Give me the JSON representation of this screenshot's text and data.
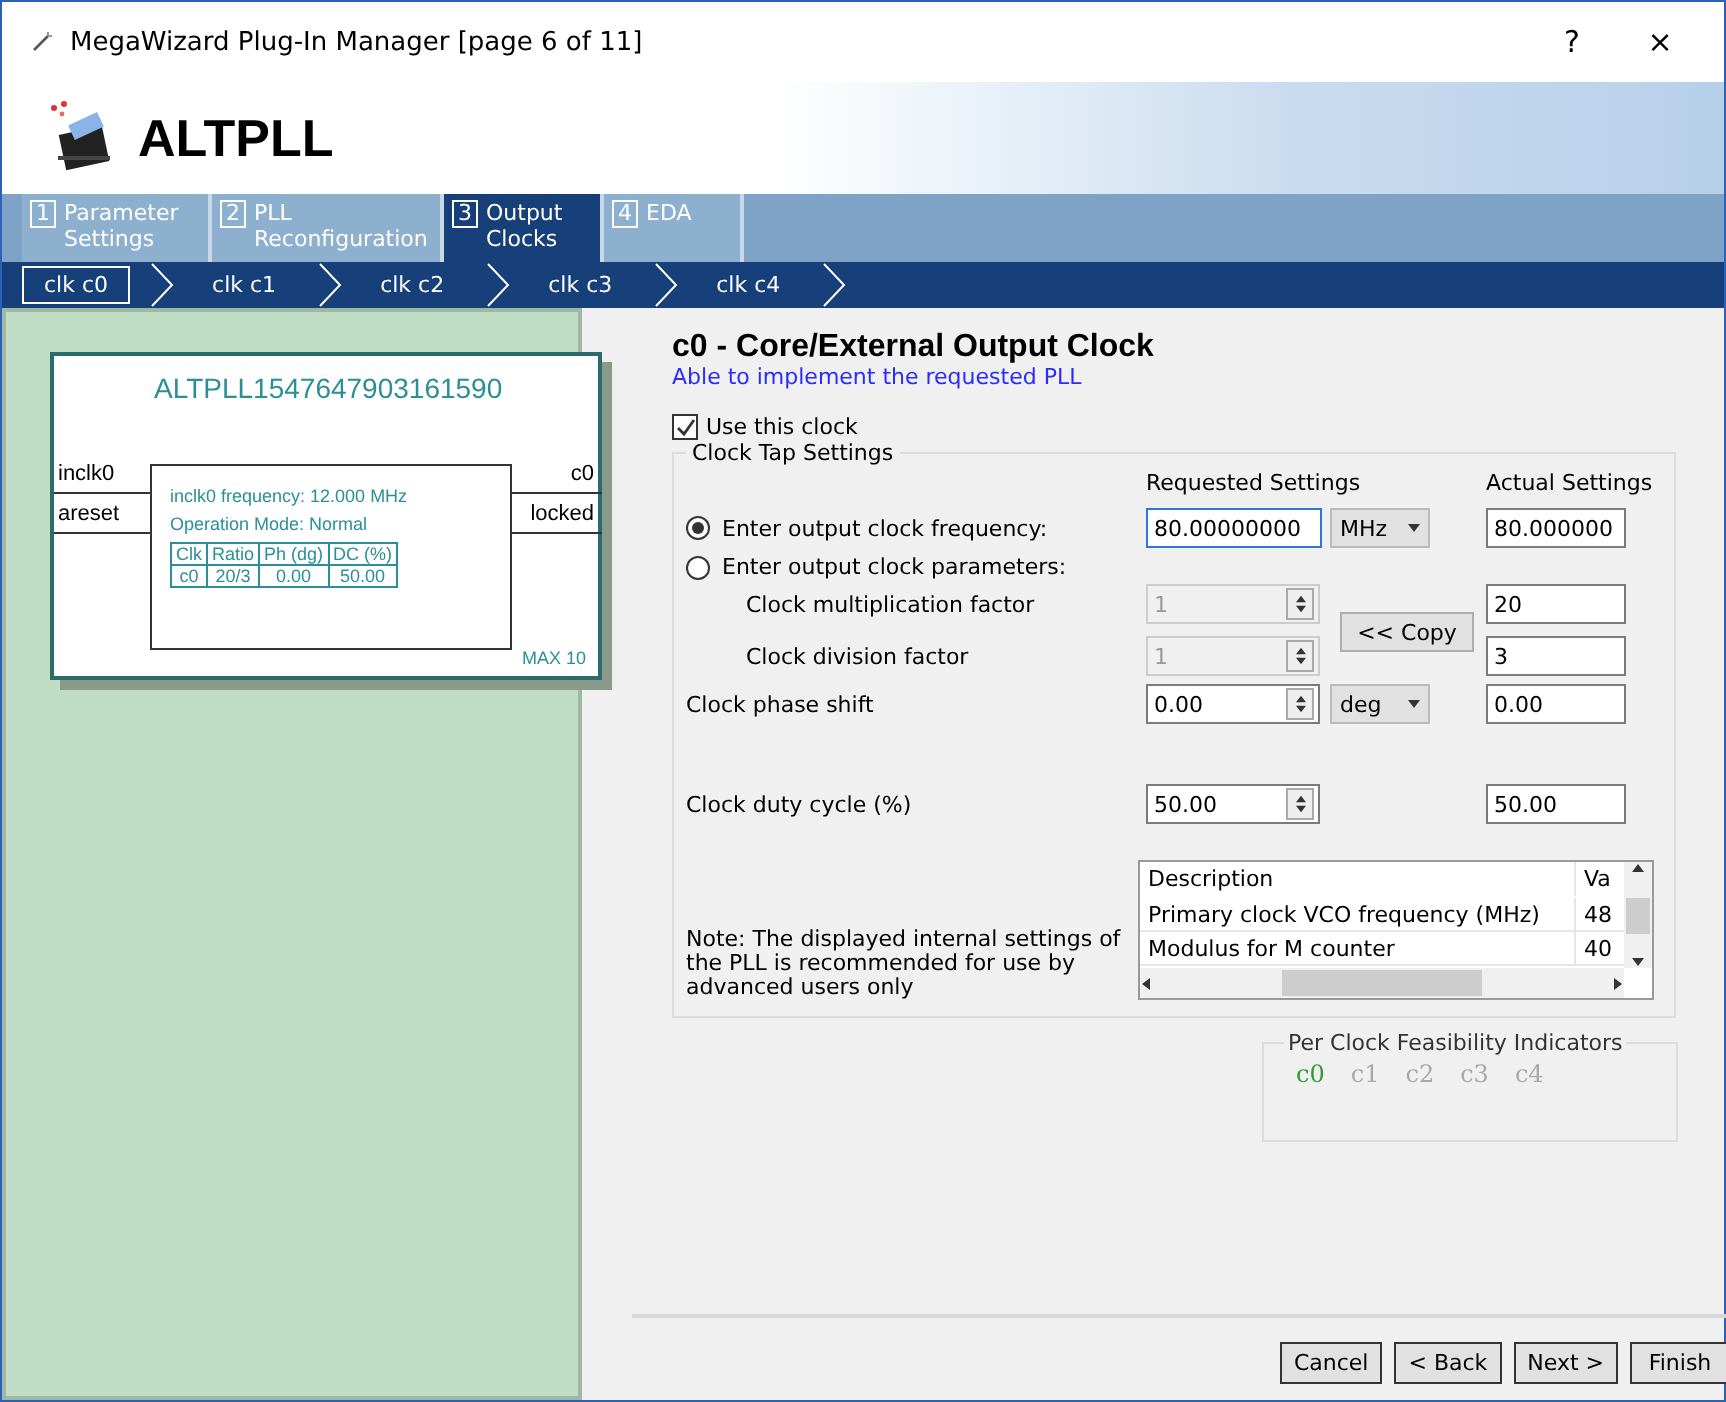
{
  "window": {
    "title": "MegaWizard Plug-In Manager [page 6 of 11]",
    "help": "?",
    "close": "×"
  },
  "header": {
    "title": "ALTPLL"
  },
  "tabs": [
    {
      "number": "1",
      "label": "Parameter\nSettings",
      "selected": false
    },
    {
      "number": "2",
      "label": "PLL\nReconfiguration",
      "selected": false
    },
    {
      "number": "3",
      "label": "Output\nClocks",
      "selected": true
    },
    {
      "number": "4",
      "label": "EDA",
      "selected": false
    }
  ],
  "clock_tabs": [
    {
      "label": "clk c0",
      "selected": true
    },
    {
      "label": "clk c1",
      "selected": false
    },
    {
      "label": "clk c2",
      "selected": false
    },
    {
      "label": "clk c3",
      "selected": false
    },
    {
      "label": "clk c4",
      "selected": false
    }
  ],
  "diagram": {
    "name": "ALTPLL1547647903161590",
    "inputs": [
      "inclk0",
      "areset"
    ],
    "outputs": [
      "c0",
      "locked"
    ],
    "info": [
      "inclk0 frequency: 12.000 MHz",
      "Operation Mode: Normal"
    ],
    "table": {
      "columns": [
        "Clk",
        "Ratio",
        "Ph (dg)",
        "DC (%)"
      ],
      "rows": [
        [
          "c0",
          "20/3",
          "0.00",
          "50.00"
        ]
      ]
    },
    "device": "MAX 10"
  },
  "panel": {
    "title": "c0 - Core/External Output Clock",
    "status": "Able to implement the requested PLL",
    "use_clock": {
      "label": "Use this clock",
      "checked": true
    },
    "group": {
      "title": "Clock Tap Settings",
      "requested_heading": "Requested Settings",
      "actual_heading": "Actual Settings",
      "mode_frequency": {
        "label": "Enter output clock frequency:",
        "selected": true,
        "value": "80.00000000",
        "unit": "MHz",
        "actual": "80.000000"
      },
      "mode_parameters": {
        "label": "Enter output clock parameters:",
        "selected": false
      },
      "multiplication": {
        "label": "Clock multiplication factor",
        "value": "1",
        "disabled": true,
        "actual": "20"
      },
      "division": {
        "label": "Clock division factor",
        "value": "1",
        "disabled": true,
        "actual": "3"
      },
      "copy_button": "<< Copy",
      "phase": {
        "label": "Clock phase shift",
        "value": "0.00",
        "unit": "deg",
        "actual": "0.00"
      },
      "duty": {
        "label": "Clock duty cycle (%)",
        "value": "50.00",
        "actual": "50.00"
      },
      "note": "Note: The displayed internal settings of the PLL is recommended for use by advanced users only",
      "settings_table": {
        "columns": [
          "Description",
          "Va"
        ],
        "rows": [
          [
            "Primary clock VCO frequency (MHz)",
            "48"
          ],
          [
            "Modulus for M counter",
            "40"
          ]
        ]
      }
    },
    "feasibility": {
      "title": "Per Clock Feasibility Indicators",
      "clocks": [
        {
          "label": "c0",
          "color": "#2e9a2e"
        },
        {
          "label": "c1",
          "color": "#a8a8a8"
        },
        {
          "label": "c2",
          "color": "#a8a8a8"
        },
        {
          "label": "c3",
          "color": "#a8a8a8"
        },
        {
          "label": "c4",
          "color": "#a8a8a8"
        }
      ]
    }
  },
  "buttons": [
    "Cancel",
    "< Back",
    "Next >",
    "Finish"
  ]
}
